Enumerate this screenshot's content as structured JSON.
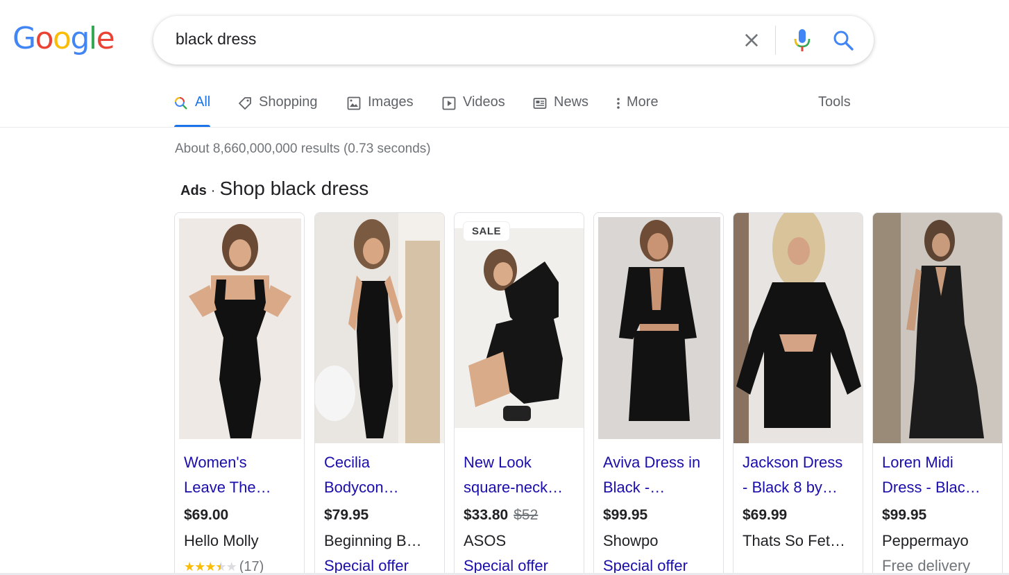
{
  "logo": {
    "letters": [
      "G",
      "o",
      "o",
      "g",
      "l",
      "e"
    ],
    "colors": [
      "#4285F4",
      "#EA4335",
      "#FBBC05",
      "#4285F4",
      "#34A853",
      "#EA4335"
    ]
  },
  "search": {
    "query": "black dress",
    "icons": [
      "close-icon",
      "mic-icon",
      "search-icon"
    ]
  },
  "tabs": [
    {
      "label": "All",
      "icon": "search-icon"
    },
    {
      "label": "Shopping",
      "icon": "tag-icon"
    },
    {
      "label": "Images",
      "icon": "image-icon"
    },
    {
      "label": "Videos",
      "icon": "play-icon"
    },
    {
      "label": "News",
      "icon": "news-icon"
    },
    {
      "label": "More",
      "icon": "more-vert-icon"
    }
  ],
  "tools_label": "Tools",
  "stats": "About 8,660,000,000 results (0.73 seconds)",
  "ads": {
    "label": "Ads",
    "separator": "·",
    "heading": "Shop black dress"
  },
  "products": [
    {
      "title1": "Women's",
      "title2": "Leave The…",
      "price": "$69.00",
      "old_price": "",
      "merchant": "Hello Molly",
      "extra": "",
      "rating": 3.5,
      "reviews": "(17)",
      "badge": ""
    },
    {
      "title1": "Cecilia",
      "title2": "Bodycon…",
      "price": "$79.95",
      "old_price": "",
      "merchant": "Beginning B…",
      "extra": "Special offer",
      "badge": ""
    },
    {
      "title1": "New Look",
      "title2": "square-neck…",
      "price": "$33.80",
      "old_price": "$52",
      "merchant": "ASOS",
      "extra": "Special offer",
      "badge": "SALE"
    },
    {
      "title1": "Aviva Dress in",
      "title2": "Black -…",
      "price": "$99.95",
      "old_price": "",
      "merchant": "Showpo",
      "extra": "Special offer",
      "badge": ""
    },
    {
      "title1": "Jackson Dress",
      "title2": "- Black 8 by…",
      "price": "$69.99",
      "old_price": "",
      "merchant": "Thats So Fet…",
      "extra": "",
      "badge": ""
    },
    {
      "title1": "Loren Midi",
      "title2": "Dress - Blac…",
      "price": "$99.95",
      "old_price": "",
      "merchant": "Peppermayo",
      "extra": "Free delivery",
      "badge": ""
    }
  ]
}
